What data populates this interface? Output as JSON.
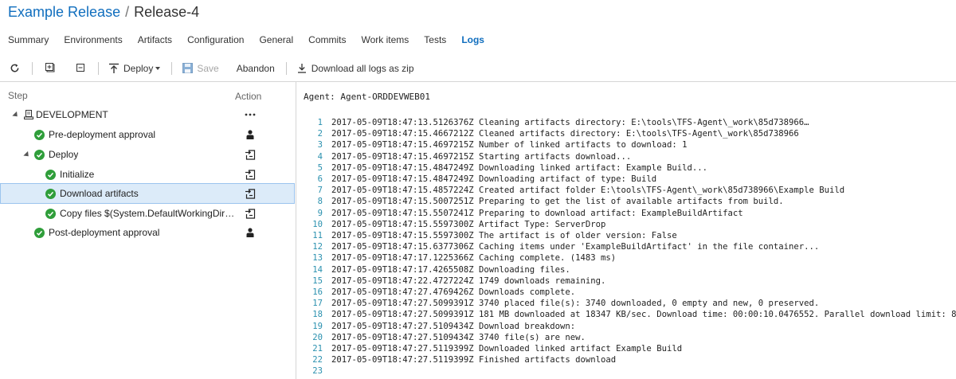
{
  "breadcrumb": {
    "parent": "Example Release",
    "separator": "/",
    "current": "Release-4"
  },
  "tabs": [
    {
      "label": "Summary",
      "active": false
    },
    {
      "label": "Environments",
      "active": false
    },
    {
      "label": "Artifacts",
      "active": false
    },
    {
      "label": "Configuration",
      "active": false
    },
    {
      "label": "General",
      "active": false
    },
    {
      "label": "Commits",
      "active": false
    },
    {
      "label": "Work items",
      "active": false
    },
    {
      "label": "Tests",
      "active": false
    },
    {
      "label": "Logs",
      "active": true
    }
  ],
  "toolbar": {
    "deploy_label": "Deploy",
    "save_label": "Save",
    "abandon_label": "Abandon",
    "download_label": "Download all logs as zip"
  },
  "left_panel": {
    "step_header": "Step",
    "action_header": "Action",
    "steps": [
      {
        "label": "DEVELOPMENT",
        "kind": "environment",
        "action": "ellipsis-icon",
        "selected": false
      },
      {
        "label": "Pre-deployment approval",
        "kind": "approval",
        "action": "approver-icon",
        "selected": false
      },
      {
        "label": "Deploy",
        "kind": "phase",
        "action": "deploy-action-icon",
        "selected": false
      },
      {
        "label": "Initialize",
        "kind": "task",
        "action": "deploy-action-icon",
        "selected": false
      },
      {
        "label": "Download artifacts",
        "kind": "task",
        "action": "deploy-action-icon",
        "selected": true
      },
      {
        "label": "Copy files $(System.DefaultWorkingDirec...",
        "kind": "task",
        "action": "deploy-action-icon",
        "selected": false
      },
      {
        "label": "Post-deployment approval",
        "kind": "approval",
        "action": "approver-icon",
        "selected": false
      }
    ]
  },
  "agent": {
    "label": "Agent: Agent-ORDDEVWEB01"
  },
  "log_lines": [
    {
      "num": "1",
      "text": "2017-05-09T18:47:13.5126376Z Cleaning artifacts directory: E:\\tools\\TFS-Agent\\_work\\85d738966…"
    },
    {
      "num": "2",
      "text": "2017-05-09T18:47:15.4667212Z Cleaned artifacts directory: E:\\tools\\TFS-Agent\\_work\\85d738966"
    },
    {
      "num": "3",
      "text": "2017-05-09T18:47:15.4697215Z Number of linked artifacts to download: 1"
    },
    {
      "num": "4",
      "text": "2017-05-09T18:47:15.4697215Z Starting artifacts download..."
    },
    {
      "num": "5",
      "text": "2017-05-09T18:47:15.4847249Z Downloading linked artifact: Example Build..."
    },
    {
      "num": "6",
      "text": "2017-05-09T18:47:15.4847249Z Downloading artifact of type: Build"
    },
    {
      "num": "7",
      "text": "2017-05-09T18:47:15.4857224Z Created artifact folder E:\\tools\\TFS-Agent\\_work\\85d738966\\Example Build"
    },
    {
      "num": "8",
      "text": "2017-05-09T18:47:15.5007251Z Preparing to get the list of available artifacts from build."
    },
    {
      "num": "9",
      "text": "2017-05-09T18:47:15.5507241Z Preparing to download artifact: ExampleBuildArtifact"
    },
    {
      "num": "10",
      "text": "2017-05-09T18:47:15.5597300Z Artifact Type: ServerDrop"
    },
    {
      "num": "11",
      "text": "2017-05-09T18:47:15.5597300Z The artifact is of older version: False"
    },
    {
      "num": "12",
      "text": "2017-05-09T18:47:15.6377306Z Caching items under 'ExampleBuildArtifact' in the file container..."
    },
    {
      "num": "13",
      "text": "2017-05-09T18:47:17.1225366Z Caching complete. (1483 ms)"
    },
    {
      "num": "14",
      "text": "2017-05-09T18:47:17.4265508Z Downloading files."
    },
    {
      "num": "15",
      "text": "2017-05-09T18:47:22.4727224Z 1749 downloads remaining."
    },
    {
      "num": "16",
      "text": "2017-05-09T18:47:27.4769426Z Downloads complete."
    },
    {
      "num": "17",
      "text": "2017-05-09T18:47:27.5099391Z 3740 placed file(s): 3740 downloaded, 0 empty and new, 0 preserved."
    },
    {
      "num": "18",
      "text": "2017-05-09T18:47:27.5099391Z 181 MB downloaded at 18347 KB/sec. Download time: 00:00:10.0476552. Parallel download limit: 8."
    },
    {
      "num": "19",
      "text": "2017-05-09T18:47:27.5109434Z Download breakdown:"
    },
    {
      "num": "20",
      "text": "2017-05-09T18:47:27.5109434Z 3740 file(s) are new."
    },
    {
      "num": "21",
      "text": "2017-05-09T18:47:27.5119399Z Downloaded linked artifact Example Build"
    },
    {
      "num": "22",
      "text": "2017-05-09T18:47:27.5119399Z Finished artifacts download"
    },
    {
      "num": "23",
      "text": ""
    }
  ],
  "colors": {
    "link": "#106ebe",
    "success": "#2f9e3a",
    "selection": "#dcebf9",
    "line_number": "#2b91af"
  }
}
